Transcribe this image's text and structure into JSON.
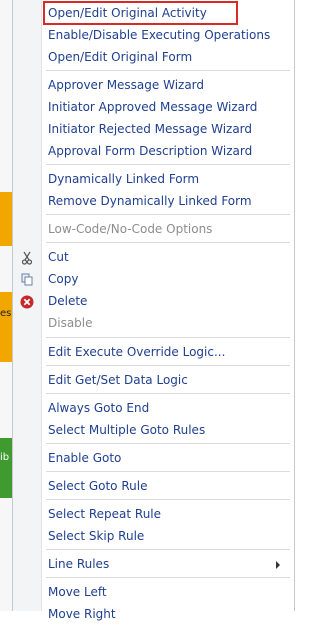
{
  "menu": {
    "items": [
      {
        "label": "Open/Edit Original Activity"
      },
      {
        "label": "Enable/Disable Executing Operations"
      },
      {
        "label": "Open/Edit Original Form"
      },
      {
        "label": "Approver Message Wizard"
      },
      {
        "label": "Initiator Approved Message Wizard"
      },
      {
        "label": "Initiator Rejected Message Wizard"
      },
      {
        "label": "Approval Form Description Wizard"
      },
      {
        "label": "Dynamically Linked Form"
      },
      {
        "label": "Remove Dynamically Linked Form"
      },
      {
        "label": "Low-Code/No-Code Options"
      },
      {
        "label": "Cut"
      },
      {
        "label": "Copy"
      },
      {
        "label": "Delete"
      },
      {
        "label": "Disable"
      },
      {
        "label": "Edit Execute Override Logic..."
      },
      {
        "label": "Edit Get/Set Data Logic"
      },
      {
        "label": "Always Goto End"
      },
      {
        "label": "Select Multiple Goto Rules"
      },
      {
        "label": "Enable Goto"
      },
      {
        "label": "Select Goto Rule"
      },
      {
        "label": "Select Repeat Rule"
      },
      {
        "label": "Select Skip Rule"
      },
      {
        "label": "Line Rules"
      },
      {
        "label": "Move Left"
      },
      {
        "label": "Move Right"
      }
    ]
  },
  "background": {
    "label_1": "es",
    "label_2": "ib"
  },
  "colors": {
    "accent": "#1f3f8f",
    "highlight_border": "#d92a2a",
    "delete_icon": "#c62828"
  }
}
